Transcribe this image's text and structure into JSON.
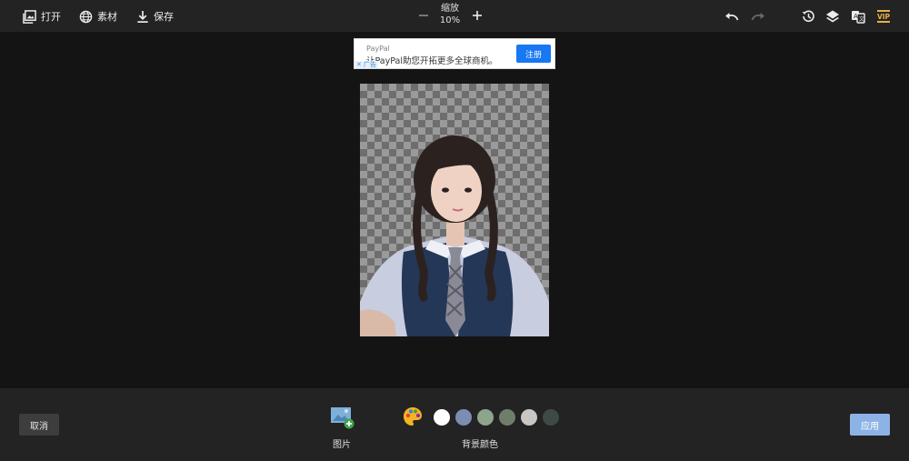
{
  "toolbar": {
    "open_label": "打开",
    "assets_label": "素材",
    "save_label": "保存",
    "zoom_label": "缩放",
    "zoom_value": "10%",
    "vip_label": "VIP"
  },
  "ad": {
    "brand": "PayPal",
    "text": "让PayPal助您开拓更多全球商机。",
    "cta": "注册",
    "mark": "广告"
  },
  "bottom": {
    "cancel_label": "取消",
    "image_label": "图片",
    "bg_color_label": "背景颜色",
    "apply_label": "应用",
    "swatches": [
      "#ffffff",
      "#7b8db3",
      "#8ea58d",
      "#6f7e68",
      "#c9c7c4",
      "#3e4b45"
    ]
  },
  "colors": {
    "topbar": "#232323",
    "canvas_bg": "#141414",
    "apply_button": "#8db3e6",
    "ad_cta": "#1877f2"
  }
}
